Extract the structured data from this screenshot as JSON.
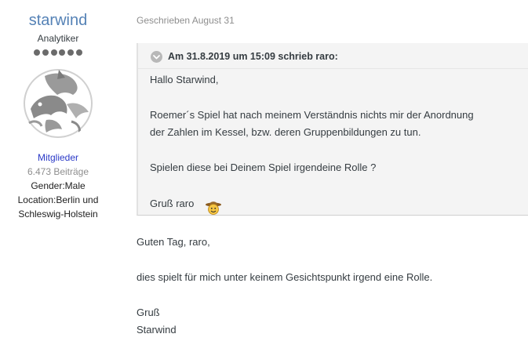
{
  "author": {
    "name": "starwind",
    "title": "Analytiker",
    "rank_pips": 6,
    "group": "Mitglieder",
    "posts": "6.473 Beiträge",
    "gender": "Gender:Male",
    "location_line1": "Location:Berlin und",
    "location_line2": "Schleswig-Holstein"
  },
  "post": {
    "date": "Geschrieben August 31",
    "quote": {
      "citation": "Am 31.8.2019 um 15:09 schrieb raro:",
      "line1": "Hallo Starwind,",
      "line2": "Roemer´s Spiel hat nach meinem Verständnis nichts mir der Anordnung",
      "line3": "der Zahlen im Kessel, bzw. deren Gruppenbildungen zu tun.",
      "line4": "Spielen diese bei Deinem Spiel irgendeine Rolle ?",
      "line5": "Gruß raro"
    },
    "reply": {
      "line1": "Guten Tag, raro,",
      "line2": "dies spielt für mich unter keinem Gesichtspunkt irgend eine Rolle.",
      "line3": "Gruß",
      "line4": "Starwind"
    }
  },
  "icons": {
    "avatar": "dolphin-avatar",
    "quote_toggle": "chevron-down-icon",
    "smiley": "cowboy-smiley-icon"
  },
  "colors": {
    "author_name": "#5582b6",
    "group": "#2a39c7",
    "muted": "#8e8e8e",
    "quote_bg": "#f4f4f4"
  }
}
